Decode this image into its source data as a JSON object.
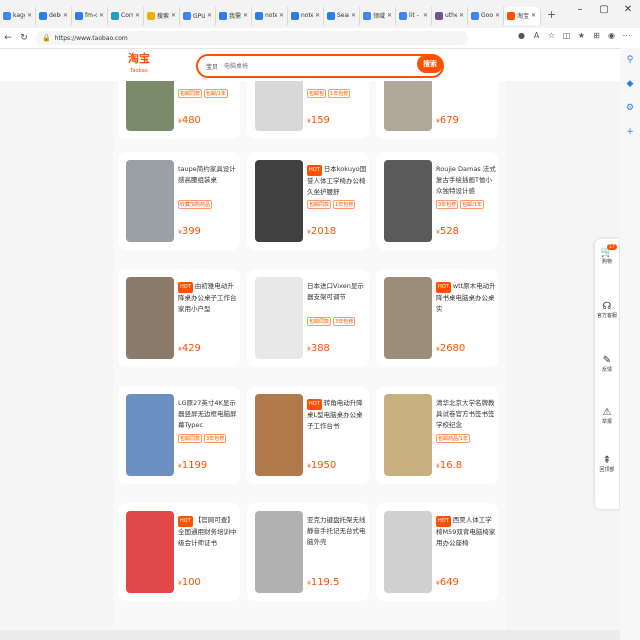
{
  "browser": {
    "tabs": [
      {
        "label": "kaggle",
        "color": "#4285f4"
      },
      {
        "label": "debertz",
        "color": "#2b7de9"
      },
      {
        "label": "fm-chec",
        "color": "#2b7de9"
      },
      {
        "label": "Corrupt",
        "color": "#20a0c0"
      },
      {
        "label": "搜索 Mi",
        "color": "#e8b400"
      },
      {
        "label": "GPU 云",
        "color": "#4285f4"
      },
      {
        "label": "我需要知",
        "color": "#2b7de9"
      },
      {
        "label": "notebo",
        "color": "#2b7de9"
      },
      {
        "label": "notebo",
        "color": "#2b7de9"
      },
      {
        "label": "Search",
        "color": "#2b7de9"
      },
      {
        "label": "领域pyc",
        "color": "#4285f4"
      },
      {
        "label": "lit - Goo",
        "color": "#4285f4"
      },
      {
        "label": "uthelyh",
        "color": "#6e5494"
      },
      {
        "label": "Google",
        "color": "#4285f4"
      },
      {
        "label": "淘宝",
        "color": "#ff5000",
        "active": true
      }
    ],
    "url": "https://www.taobao.com"
  },
  "header": {
    "logo_main": "淘宝",
    "logo_sub": "Taobao",
    "search_scope": "宝贝",
    "search_placeholder": "电脑桌椅",
    "search_button": "搜索"
  },
  "float_panel": {
    "cart": {
      "label": "购物",
      "badge": "17"
    },
    "service": {
      "label": "官方客服"
    },
    "feedback": {
      "label": "反馈"
    },
    "report": {
      "label": "举报"
    },
    "top": {
      "label": "回顶部"
    }
  },
  "products": [
    {
      "title": "",
      "hot": false,
      "tags": [
        "包邮同款",
        "包邮/1年"
      ],
      "price": "480",
      "img": "#7a8a6a"
    },
    {
      "title": "",
      "hot": false,
      "tags": [
        "包邮包",
        "1年包修"
      ],
      "price": "159",
      "img": "#d8d8d8"
    },
    {
      "title": "",
      "hot": false,
      "tags": [],
      "price": "679",
      "img": "#b0a89a"
    },
    {
      "title": "taupe简约家具设计感高腰组装桌",
      "hot": false,
      "tags": [
        "收藏加购商品"
      ],
      "price": "399",
      "img": "#9aa0a6"
    },
    {
      "title": "日本kokuyo国誉人体工学椅办公椅久坐护腰舒",
      "hot": true,
      "tags": [
        "包邮同款",
        "1年包修"
      ],
      "price": "2018",
      "img": "#404040"
    },
    {
      "title": "Roujie Damas 法式复古手绘插画T恤小众独特设计感",
      "hot": false,
      "tags": [
        "3年包修",
        "包邮/1年"
      ],
      "price": "528",
      "img": "#5a5a5a"
    },
    {
      "title": "由初雅电动升降桌办公桌子工作台家用小户型",
      "hot": true,
      "tags": [],
      "price": "429",
      "img": "#8a7a6a"
    },
    {
      "title": "日本进口Vixen显示器支架可调节",
      "hot": false,
      "tags": [
        "包邮同款",
        "3年包修"
      ],
      "price": "388",
      "img": "#e8e8e8"
    },
    {
      "title": "wtt原木电动升降书桌电脑桌办公桌实",
      "hot": true,
      "tags": [],
      "price": "2680",
      "img": "#9a8e7a"
    },
    {
      "title": "LG原27英寸4K显示器竖屏无边框电脑屏幕Typec",
      "hot": false,
      "tags": [
        "包邮同款",
        "3年包修"
      ],
      "price": "1199",
      "img": "#6b8fc0"
    },
    {
      "title": "转角电动升降桌L型电脑桌办公桌子工作台书",
      "hot": true,
      "tags": [],
      "price": "1950",
      "img": "#b07a4a"
    },
    {
      "title": "清华北京大学名牌教具试卷官方书签书签学校纪念",
      "hot": false,
      "tags": [
        "包邮商品/1年"
      ],
      "price": "16.8",
      "img": "#c8b080"
    },
    {
      "title": "【官网可查】全国通用财务培训中级会计师证书",
      "hot": true,
      "tags": [],
      "price": "100",
      "img": "#e0484a"
    },
    {
      "title": "亚克力键盘托架无线静音手托记无台式电脑外壳",
      "hot": false,
      "tags": [],
      "price": "119.5",
      "img": "#b0b0b0"
    },
    {
      "title": "西昊人体工学椅M59双背电脑椅家用办公座椅",
      "hot": true,
      "tags": [],
      "price": "649",
      "img": "#d0d0d0"
    }
  ]
}
